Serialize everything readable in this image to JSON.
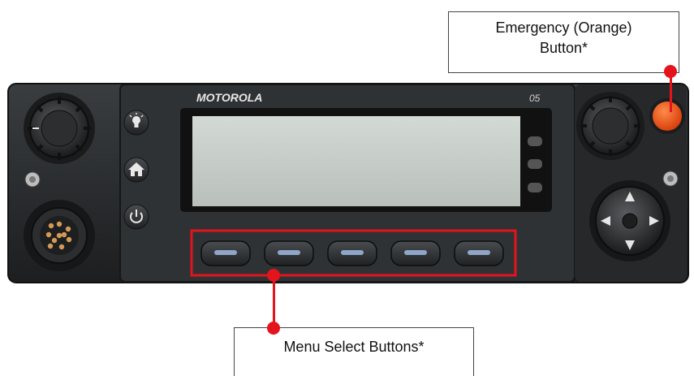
{
  "device": {
    "brand": "MOTOROLA",
    "channel_number": "05",
    "menu_button_count": 5
  },
  "callouts": {
    "emergency_line1": "Emergency (Orange)",
    "emergency_line2": "Button*",
    "menu_select": "Menu Select Buttons*"
  },
  "colors": {
    "callout_line": "#e3141c",
    "emergency_button": "#e8561c",
    "lcd": "#c9cfca",
    "chassis": "#2a2c2e"
  },
  "icons": [
    "lightbulb-icon",
    "home-icon",
    "power-icon"
  ]
}
